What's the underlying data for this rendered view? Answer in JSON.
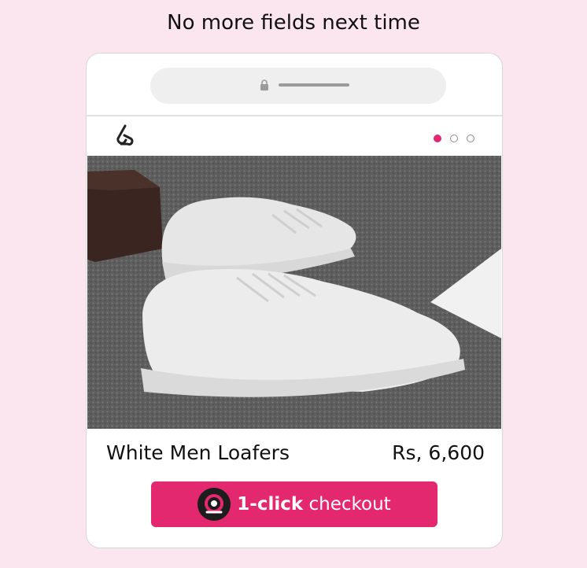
{
  "headline": "No more fields next time",
  "browser": {
    "lock_icon": "lock-icon"
  },
  "store": {
    "logo_icon": "store-logo-icon",
    "carousel": {
      "total": 3,
      "active_index": 0
    }
  },
  "product": {
    "image": "white-men-loafers-photo",
    "name": "White Men Loafers",
    "price": "Rs, 6,600"
  },
  "checkout": {
    "icon": "checkout-brand-icon",
    "label_bold": "1-click",
    "label_rest": "checkout",
    "color": "#e4286f"
  },
  "colors": {
    "background": "#fbe6ef",
    "accent": "#e4286f"
  }
}
